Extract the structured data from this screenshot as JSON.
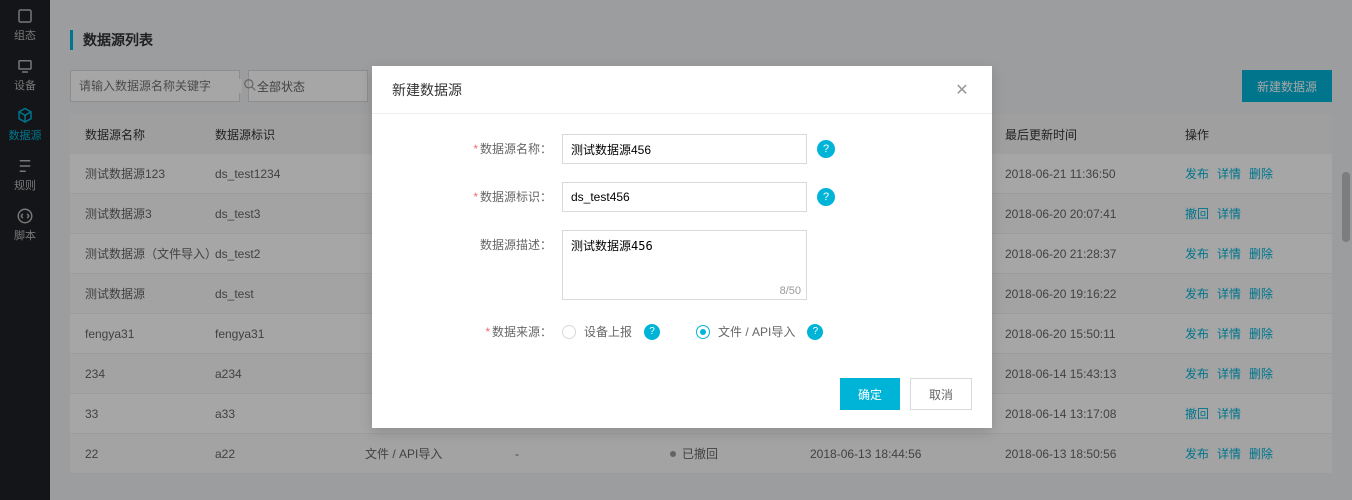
{
  "sidebar": {
    "items": [
      {
        "label": "组态"
      },
      {
        "label": "设备"
      },
      {
        "label": "数据源"
      },
      {
        "label": "规则"
      },
      {
        "label": "脚本"
      }
    ]
  },
  "page": {
    "title": "数据源列表"
  },
  "toolbar": {
    "search_placeholder": "请输入数据源名称关键字",
    "status_select": "全部状态",
    "new_btn": "新建数据源"
  },
  "table": {
    "headers": {
      "name": "数据源名称",
      "ident": "数据源标识",
      "src": "",
      "desc": "",
      "status": "",
      "create": "",
      "update": "最后更新时间",
      "actions": "操作"
    },
    "rows": [
      {
        "name": "测试数据源123",
        "ident": "ds_test1234",
        "src": "",
        "desc": "",
        "status": "",
        "create": "",
        "update": "2018-06-21 11:36:50",
        "actions": [
          "发布",
          "详情",
          "删除"
        ]
      },
      {
        "name": "测试数据源3",
        "ident": "ds_test3",
        "src": "",
        "desc": "",
        "status": "",
        "create": "",
        "update": "2018-06-20 20:07:41",
        "actions": [
          "撤回",
          "详情"
        ]
      },
      {
        "name": "测试数据源（文件导入）",
        "ident": "ds_test2",
        "src": "",
        "desc": "",
        "status": "",
        "create": "",
        "update": "2018-06-20 21:28:37",
        "actions": [
          "发布",
          "详情",
          "删除"
        ]
      },
      {
        "name": "测试数据源",
        "ident": "ds_test",
        "src": "",
        "desc": "",
        "status": "",
        "create": "",
        "update": "2018-06-20 19:16:22",
        "actions": [
          "发布",
          "详情",
          "删除"
        ]
      },
      {
        "name": "fengya31",
        "ident": "fengya31",
        "src": "",
        "desc": "",
        "status": "",
        "create": "",
        "update": "2018-06-20 15:50:11",
        "actions": [
          "发布",
          "详情",
          "删除"
        ]
      },
      {
        "name": "234",
        "ident": "a234",
        "src": "",
        "desc": "",
        "status": "",
        "create": "",
        "update": "2018-06-14 15:43:13",
        "actions": [
          "发布",
          "详情",
          "删除"
        ]
      },
      {
        "name": "33",
        "ident": "a33",
        "src": "",
        "desc": "",
        "status": "",
        "create": "",
        "update": "2018-06-14 13:17:08",
        "actions": [
          "撤回",
          "详情"
        ]
      },
      {
        "name": "22",
        "ident": "a22",
        "src": "文件 / API导入",
        "desc": "-",
        "status": "已撤回",
        "create": "2018-06-13 18:44:56",
        "update": "2018-06-13 18:50:56",
        "actions": [
          "发布",
          "详情",
          "删除"
        ]
      }
    ]
  },
  "modal": {
    "title": "新建数据源",
    "labels": {
      "name": "数据源名称：",
      "ident": "数据源标识：",
      "desc": "数据源描述：",
      "source": "数据来源："
    },
    "values": {
      "name": "测试数据源456",
      "ident": "ds_test456",
      "desc": "测试数据源456"
    },
    "char_count": "8/50",
    "source_options": {
      "device": "设备上报",
      "file": "文件 / API导入"
    },
    "source_selected": "file",
    "ok": "确定",
    "cancel": "取消"
  }
}
